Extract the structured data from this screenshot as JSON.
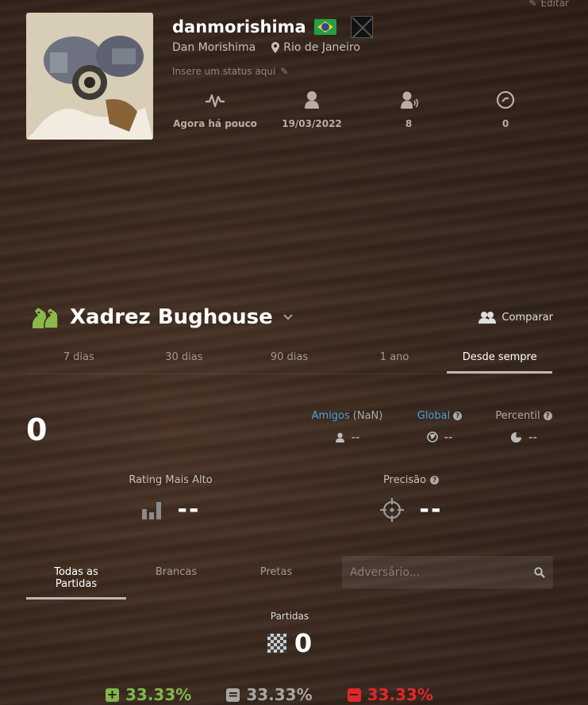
{
  "header": {
    "edit_label": "Editar",
    "username": "danmorishima",
    "real_name": "Dan Morishima",
    "location": "Rio de Janeiro",
    "status_placeholder": "Insere um status aqui",
    "stats": [
      {
        "icon": "activity-icon",
        "value": "Agora há pouco"
      },
      {
        "icon": "user-joined-icon",
        "value": "19/03/2022"
      },
      {
        "icon": "followers-icon",
        "value": "8"
      },
      {
        "icon": "points-icon",
        "value": "0"
      }
    ]
  },
  "game": {
    "title": "Xadrez Bughouse",
    "compare_label": "Comparar",
    "period_tabs": [
      "7 dias",
      "30 dias",
      "90 dias",
      "1 ano",
      "Desde sempre"
    ],
    "active_period": "Desde sempre",
    "rating": "0",
    "ranks": {
      "friends_label": "Amigos",
      "friends_suffix": "(NaN)",
      "friends_value": "--",
      "global_label": "Global",
      "global_value": "--",
      "percentile_label": "Percentil",
      "percentile_value": "--"
    },
    "highest_label": "Rating Mais Alto",
    "highest_value": "--",
    "accuracy_label": "Precisão",
    "accuracy_value": "--"
  },
  "games_filter": {
    "tabs": [
      "Todas as Partidas",
      "Brancas",
      "Pretas"
    ],
    "active": "Todas as Partidas",
    "search_placeholder": "Adversário..."
  },
  "summary": {
    "games_label": "Partidas",
    "games_count": "0",
    "win_pct": "33.33%",
    "draw_pct": "33.33%",
    "loss_pct": "33.33%"
  },
  "colors": {
    "win": "#81b64c",
    "draw": "#a7a6a2",
    "loss": "#e02828",
    "link": "#4aa3df",
    "game_icon": "#8bb84a"
  }
}
